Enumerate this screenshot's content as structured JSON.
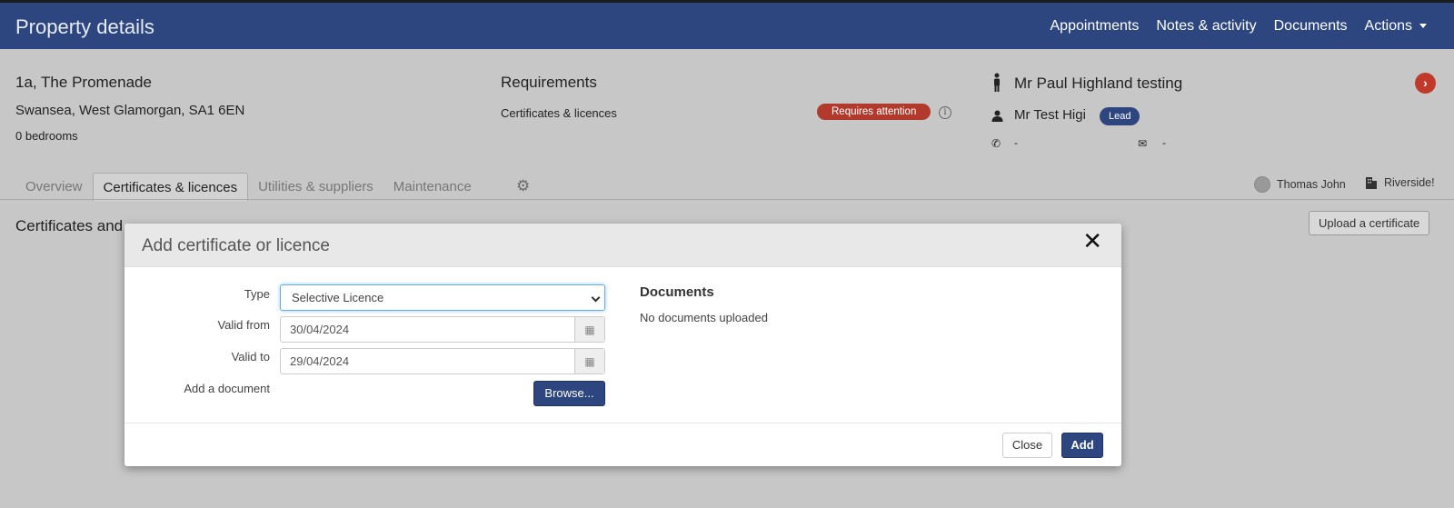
{
  "app": {
    "title": "Property details",
    "nav": [
      "Appointments",
      "Notes & activity",
      "Documents",
      "Actions"
    ]
  },
  "property": {
    "address_line1": "1a, The Promenade",
    "address_line2": "Swansea, West Glamorgan, SA1 6EN",
    "bedrooms": "0 bedrooms"
  },
  "requirements": {
    "title": "Requirements",
    "item": "Certificates & licences",
    "status": "Requires attention"
  },
  "lead": {
    "name": "Mr Paul Highland testing",
    "contact_name": "Mr Test Higi",
    "badge": "Lead",
    "phone": "-",
    "email": "-"
  },
  "tabs": [
    {
      "label": "Overview",
      "active": false
    },
    {
      "label": "Certificates & licences",
      "active": true
    },
    {
      "label": "Utilities & suppliers",
      "active": false
    },
    {
      "label": "Maintenance",
      "active": false
    }
  ],
  "agent": {
    "name": "Thomas John",
    "branch": "Riverside!"
  },
  "section": {
    "title": "Certificates and",
    "upload_button": "Upload a certificate"
  },
  "modal": {
    "title": "Add certificate or licence",
    "close_symbol": "✕",
    "type_label": "Type",
    "type_value": "Selective Licence",
    "valid_from_label": "Valid from",
    "valid_from_value": "30/04/2024",
    "valid_to_label": "Valid to",
    "valid_to_value": "29/04/2024",
    "add_document_label": "Add a document",
    "browse_button": "Browse...",
    "documents_title": "Documents",
    "documents_empty": "No documents uploaded",
    "close_button": "Close",
    "add_button": "Add"
  },
  "colors": {
    "brand": "#2d4680",
    "danger": "#b23a2c"
  }
}
